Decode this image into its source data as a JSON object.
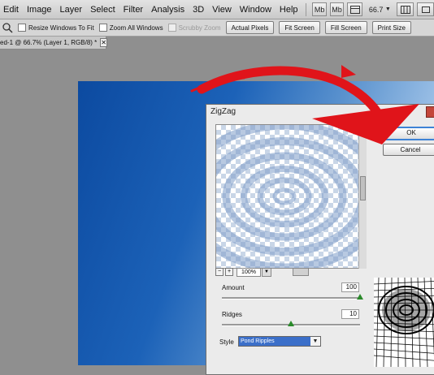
{
  "menubar": {
    "items": [
      "Edit",
      "Image",
      "Layer",
      "Select",
      "Filter",
      "Analysis",
      "3D",
      "View",
      "Window",
      "Help"
    ],
    "mb_label": "Mb",
    "zoom_value": "66.7",
    "zoom_arrow": "▼"
  },
  "options": {
    "resize_windows": "Resize Windows To Fit",
    "zoom_all_windows": "Zoom All Windows",
    "scrubby_zoom": "Scrubby Zoom",
    "actual_pixels": "Actual Pixels",
    "fit_screen": "Fit Screen",
    "fill_screen": "Fill Screen",
    "print_size": "Print Size"
  },
  "document": {
    "tab_title": "ed-1 @ 66.7% (Layer 1, RGB/8) *",
    "close_symbol": "✕"
  },
  "dialog": {
    "title": "ZigZag",
    "ok_label": "OK",
    "cancel_label": "Cancel",
    "zoom_minus": "−",
    "zoom_plus": "+",
    "zoom_value": "100%",
    "zoom_arrow": "▼",
    "amount_label": "Amount",
    "amount_value": "100",
    "amount_level": 1.0,
    "ridges_label": "Ridges",
    "ridges_value": "10",
    "ridges_level": 0.5,
    "style_label": "Style",
    "style_value": "Pond Ripples",
    "style_arrow": "▼"
  },
  "colors": {
    "arrow": "#e0141a",
    "ok_focus": "#3d83d6",
    "style_highlight": "#3b6fc9"
  },
  "icons": [
    "zoom-icon",
    "annotation-arrow"
  ]
}
